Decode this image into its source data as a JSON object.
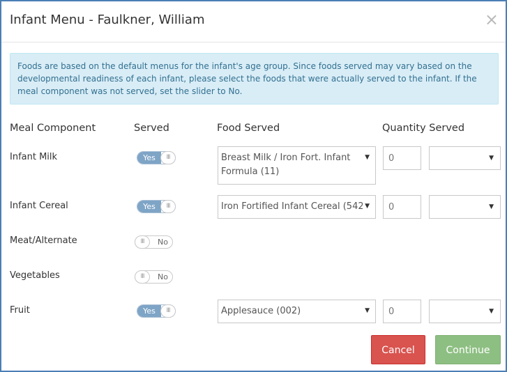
{
  "dialog": {
    "title": "Infant Menu - Faulkner, William",
    "close_glyph": "×",
    "info_text": "Foods are based on the default menus for the infant's age group. Since foods served may vary based on the developmental readiness of each infant, please select the foods that were actually served to the infant. If the meal component was not served, set the slider to No."
  },
  "table": {
    "headers": {
      "meal_component": "Meal Component",
      "served": "Served",
      "food_served": "Food Served",
      "quantity_served": "Quantity Served"
    },
    "rows": [
      {
        "component": "Infant Milk",
        "served": "Yes",
        "food": "Breast Milk / Iron Fort. Infant Formula (11)",
        "qty_placeholder": "0"
      },
      {
        "component": "Infant Cereal",
        "served": "Yes",
        "food": "Iron Fortified Infant Cereal (542)",
        "qty_placeholder": "0"
      },
      {
        "component": "Meat/Alternate",
        "served": "No"
      },
      {
        "component": "Vegetables",
        "served": "No"
      },
      {
        "component": "Fruit",
        "served": "Yes",
        "food": "Applesauce (002)",
        "qty_placeholder": "0"
      }
    ]
  },
  "toggle_knob_glyph": "III",
  "caret_glyph": "▼",
  "buttons": {
    "cancel": "Cancel",
    "continue": "Continue"
  },
  "colors": {
    "dialog_border": "#4a7fb5",
    "info_bg": "#d9edf7",
    "info_text": "#31708f",
    "toggle_on": "#7ea4c6",
    "cancel": "#d9534f",
    "continue": "#8dbf82"
  }
}
